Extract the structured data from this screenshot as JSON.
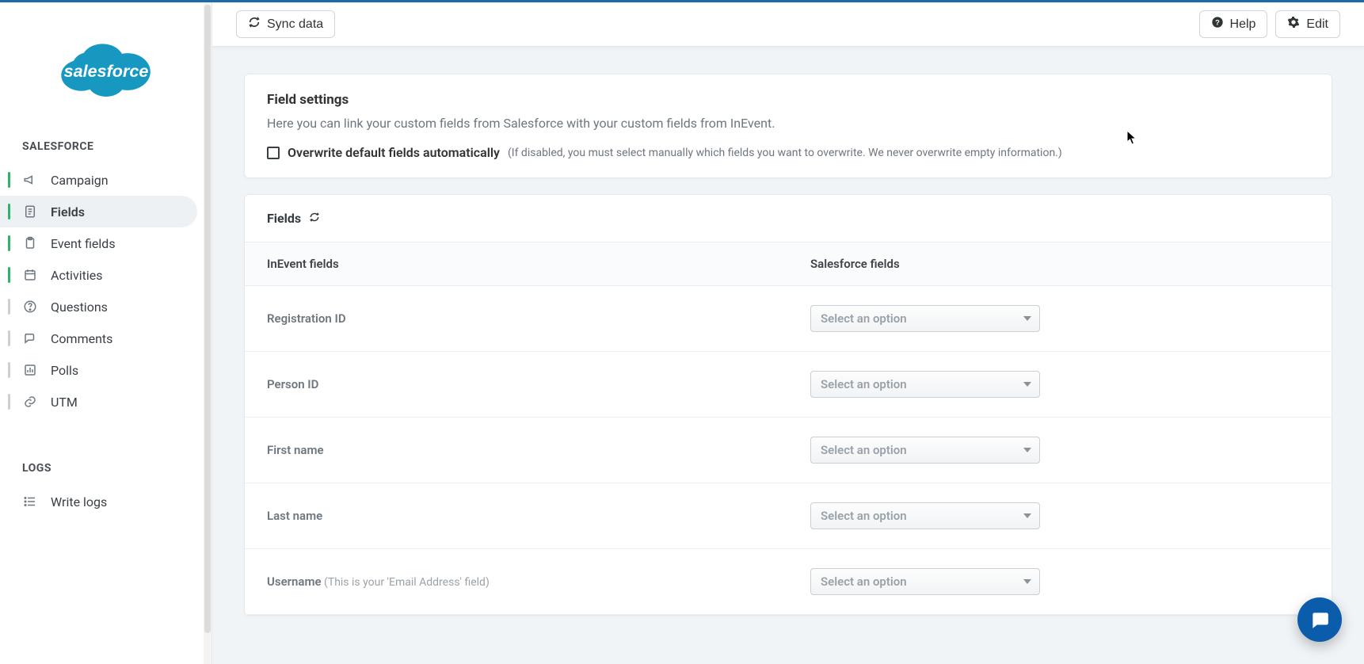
{
  "brand": {
    "name": "salesforce"
  },
  "sidebar": {
    "section_main": "SALESFORCE",
    "section_logs": "LOGS",
    "items": [
      {
        "label": "Campaign",
        "accent": "green"
      },
      {
        "label": "Fields",
        "accent": "green",
        "active": true
      },
      {
        "label": "Event fields",
        "accent": "green"
      },
      {
        "label": "Activities",
        "accent": "green"
      },
      {
        "label": "Questions",
        "accent": "gray"
      },
      {
        "label": "Comments",
        "accent": "gray"
      },
      {
        "label": "Polls",
        "accent": "gray"
      },
      {
        "label": "UTM",
        "accent": "gray"
      }
    ],
    "logs_item": {
      "label": "Write logs"
    }
  },
  "topbar": {
    "sync_label": "Sync data",
    "help_label": "Help",
    "edit_label": "Edit"
  },
  "settings_card": {
    "title": "Field settings",
    "description": "Here you can link your custom fields from Salesforce with your custom fields from InEvent.",
    "overwrite_label": "Overwrite default fields automatically",
    "overwrite_hint": "(If disabled, you must select manually which fields you want to overwrite. We never overwrite empty information.)"
  },
  "fields_card": {
    "header": "Fields",
    "columns": {
      "left": "InEvent fields",
      "right": "Salesforce fields"
    },
    "select_placeholder": "Select an option",
    "rows": [
      {
        "label": "Registration ID"
      },
      {
        "label": "Person ID"
      },
      {
        "label": "First name"
      },
      {
        "label": "Last name"
      },
      {
        "label": "Username",
        "sublabel": "(This is your 'Email Address' field)"
      }
    ]
  }
}
